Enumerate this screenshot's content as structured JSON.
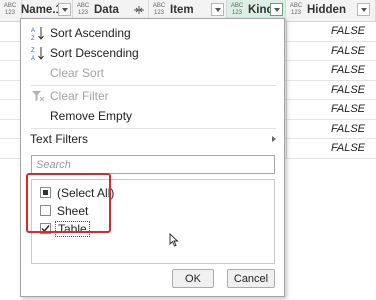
{
  "grid": {
    "columns": [
      {
        "type_top": "ABC",
        "type_bottom": "123",
        "name": "Name.1"
      },
      {
        "type_top": "ABC",
        "type_bottom": "123",
        "name": "Data"
      },
      {
        "type_top": "ABC",
        "type_bottom": "123",
        "name": "Item"
      },
      {
        "type_top": "ABC",
        "type_bottom": "123",
        "name": "Kind"
      },
      {
        "type_top": "ABC",
        "type_bottom": "123",
        "name": "Hidden"
      }
    ],
    "hidden_values": [
      "FALSE",
      "FALSE",
      "FALSE",
      "FALSE",
      "FALSE",
      "FALSE",
      "FALSE"
    ]
  },
  "menu": {
    "sort_ascending": "Sort Ascending",
    "sort_descending": "Sort Descending",
    "clear_sort": "Clear Sort",
    "clear_filter": "Clear Filter",
    "remove_empty": "Remove Empty",
    "text_filters": "Text Filters",
    "search_placeholder": "Search",
    "list": [
      {
        "label": "(Select All)",
        "state": "partial"
      },
      {
        "label": "Sheet",
        "state": "unchecked"
      },
      {
        "label": "Table",
        "state": "checked"
      }
    ],
    "ok_label": "OK",
    "cancel_label": "Cancel"
  },
  "colors": {
    "highlight_border": "#e0252f",
    "kind_column_bg": "#dcefe4"
  }
}
